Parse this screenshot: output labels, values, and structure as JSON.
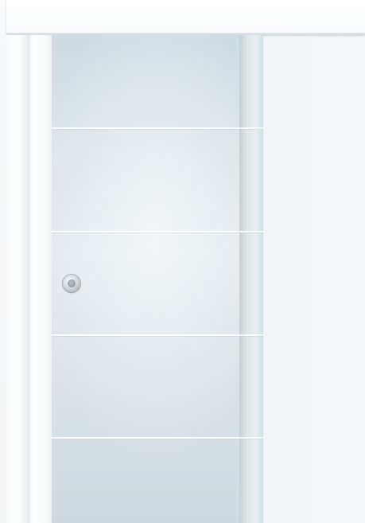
{
  "scene": {
    "subject": "sliding-glass-door",
    "colors": {
      "background": "#f4f7f9",
      "frame": "#ffffff",
      "glass": "#dce5ea",
      "handle": "#9aa6ae"
    },
    "glass_stripe_count": 4,
    "icons": [
      "door-handle-icon"
    ]
  }
}
